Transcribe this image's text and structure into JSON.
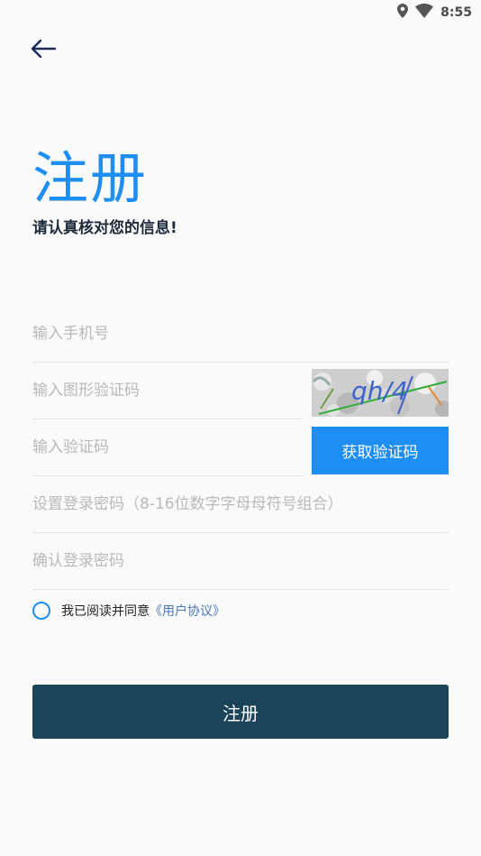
{
  "status_bar": {
    "time": "8:55",
    "icons": [
      "location-icon",
      "wifi-icon"
    ]
  },
  "header": {
    "back_icon": "arrow-left-icon"
  },
  "page": {
    "title": "注册",
    "subtitle": "请认真核对您的信息!"
  },
  "form": {
    "phone_placeholder": "输入手机号",
    "captcha_placeholder": "输入图形验证码",
    "captcha_text": "qh/4",
    "sms_code_placeholder": "输入验证码",
    "get_code_label": "获取验证码",
    "password_placeholder": "设置登录密码（8-16位数字字母母符号组合）",
    "confirm_password_placeholder": "确认登录密码"
  },
  "agreement": {
    "text": "我已阅读并同意",
    "link": "《用户协议》"
  },
  "actions": {
    "submit_label": "注册"
  },
  "colors": {
    "accent": "#1e8ef2",
    "primary_button": "#1c4458",
    "link": "#4a78b8"
  }
}
